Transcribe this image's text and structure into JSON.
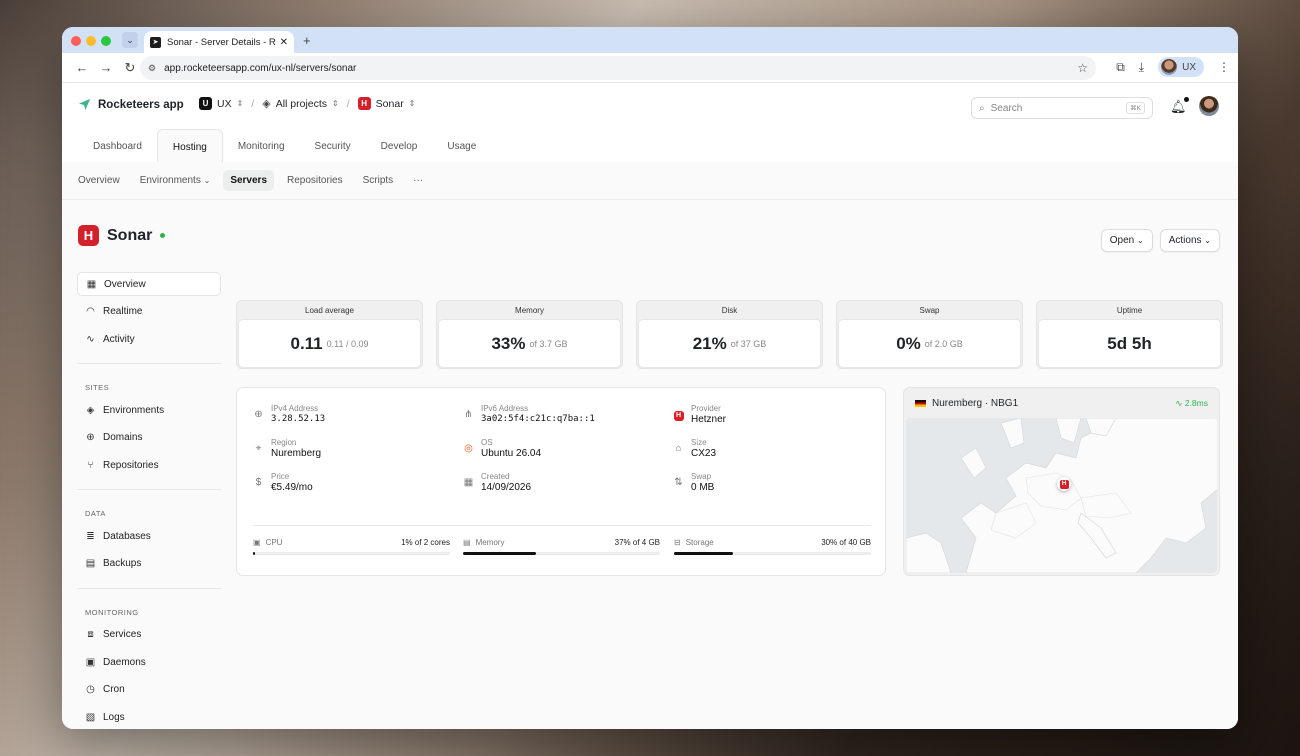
{
  "browser": {
    "tab_title": "Sonar - Server Details - Rocke",
    "url": "app.rocketeersapp.com/ux-nl/servers/sonar",
    "profile": "UX"
  },
  "app": {
    "brand": "Rocketeers app",
    "team": "UX",
    "team_badge": "U",
    "project": "All projects",
    "server": "Sonar",
    "search_placeholder": "Search",
    "search_kbd": "⌘K"
  },
  "main_tabs": [
    "Dashboard",
    "Hosting",
    "Monitoring",
    "Security",
    "Develop",
    "Usage"
  ],
  "sub_tabs": [
    "Overview",
    "Environments",
    "Servers",
    "Repositories",
    "Scripts",
    "···"
  ],
  "server": {
    "name": "Sonar",
    "open_label": "Open",
    "actions_label": "Actions"
  },
  "sidebar": {
    "top": [
      "Overview",
      "Realtime",
      "Activity"
    ],
    "sites_title": "SITES",
    "sites": [
      "Environments",
      "Domains",
      "Repositories"
    ],
    "data_title": "DATA",
    "data": [
      "Databases",
      "Backups"
    ],
    "monitoring_title": "MONITORING",
    "monitoring": [
      "Services",
      "Daemons",
      "Cron",
      "Logs"
    ]
  },
  "stats": [
    {
      "label": "Load average",
      "value": "0.11",
      "sub": "0.11 / 0.09"
    },
    {
      "label": "Memory",
      "value": "33%",
      "sub": "of 3.7 GB"
    },
    {
      "label": "Disk",
      "value": "21%",
      "sub": "of 37 GB"
    },
    {
      "label": "Swap",
      "value": "0%",
      "sub": "of 2.0 GB"
    },
    {
      "label": "Uptime",
      "value": "5d 5h",
      "sub": ""
    }
  ],
  "details": {
    "ipv4_label": "IPv4 Address",
    "ipv4": "3.28.52.13",
    "ipv6_label": "IPv6 Address",
    "ipv6": "3a02:5f4:c21c:q7ba::1",
    "provider_label": "Provider",
    "provider": "Hetzner",
    "region_label": "Region",
    "region": "Nuremberg",
    "os_label": "OS",
    "os": "Ubuntu 26.04",
    "size_label": "Size",
    "size": "CX23",
    "price_label": "Price",
    "price": "€5.49/mo",
    "created_label": "Created",
    "created": "14/09/2026",
    "swap_label": "Swap",
    "swap": "0 MB"
  },
  "usage": [
    {
      "label": "CPU",
      "text": "1% of 2 cores",
      "fraction": 0.01
    },
    {
      "label": "Memory",
      "text": "37% of 4 GB",
      "fraction": 0.37
    },
    {
      "label": "Storage",
      "text": "30% of 40 GB",
      "fraction": 0.3
    }
  ],
  "location": {
    "title": "Nuremberg · NBG1",
    "latency": "2.8ms"
  },
  "colors": {
    "accent_red": "#d3202a",
    "online_green": "#2fb34f",
    "brand_green": "#3bb58a"
  }
}
